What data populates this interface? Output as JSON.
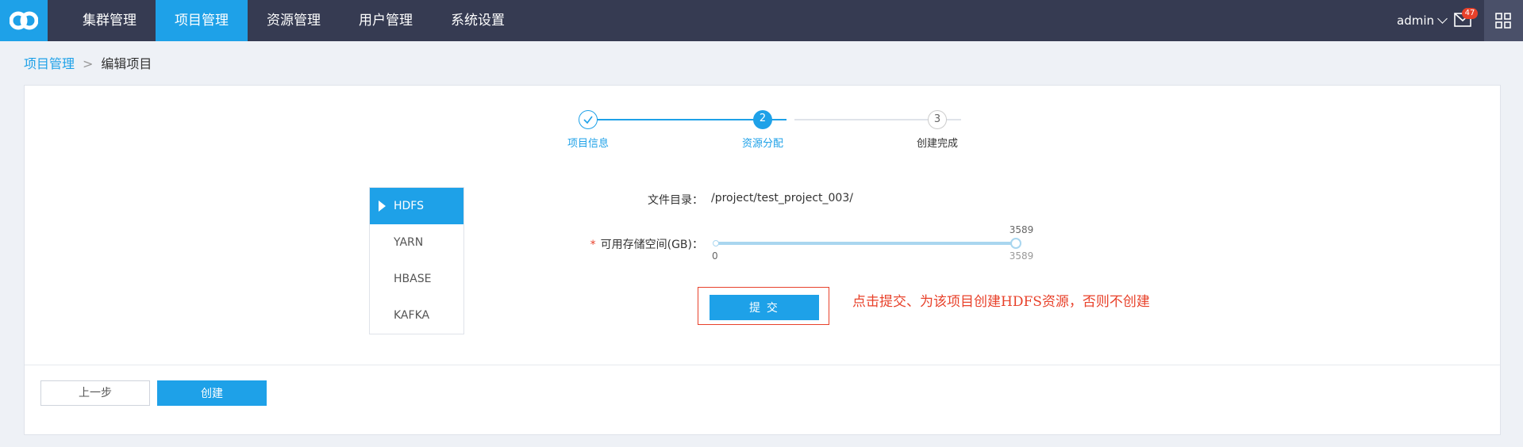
{
  "nav": {
    "items": [
      {
        "label": "集群管理",
        "active": false
      },
      {
        "label": "项目管理",
        "active": true
      },
      {
        "label": "资源管理",
        "active": false
      },
      {
        "label": "用户管理",
        "active": false
      },
      {
        "label": "系统设置",
        "active": false
      }
    ],
    "user": "admin",
    "mail_count": "47"
  },
  "breadcrumb": {
    "parent": "项目管理",
    "current": "编辑项目"
  },
  "steps": [
    {
      "num": "",
      "label": "项目信息",
      "state": "done"
    },
    {
      "num": "2",
      "label": "资源分配",
      "state": "active"
    },
    {
      "num": "3",
      "label": "创建完成",
      "state": "pending"
    }
  ],
  "tabs": [
    {
      "label": "HDFS",
      "active": true
    },
    {
      "label": "YARN",
      "active": false
    },
    {
      "label": "HBASE",
      "active": false
    },
    {
      "label": "KAFKA",
      "active": false
    }
  ],
  "form": {
    "dir_label": "文件目录：",
    "dir_value": "/project/test_project_003/",
    "required_mark": "*",
    "storage_label": "可用存储空间(GB)：",
    "slider_value": "3589",
    "slider_min": "0",
    "slider_max": "3589",
    "slider_fraction": 1.0
  },
  "submit_label": "提 交",
  "annotation": "点击提交、为该项目创建HDFS资源，否则不创建",
  "footer": {
    "prev_label": "上一步",
    "create_label": "创建"
  },
  "colors": {
    "accent": "#1ea1e8",
    "nav_bg": "#363b52",
    "danger": "#e8412a"
  }
}
